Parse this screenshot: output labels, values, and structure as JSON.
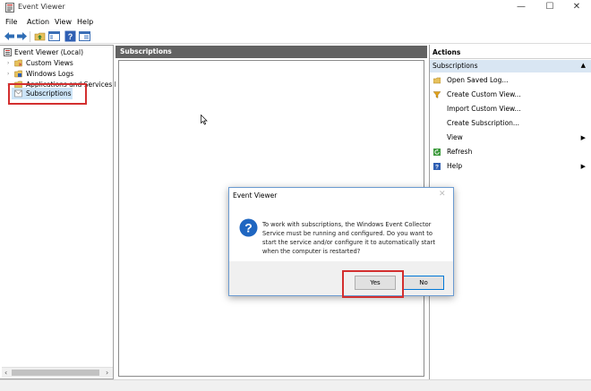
{
  "window": {
    "title": "Event Viewer",
    "minimize_glyph": "—",
    "maximize_glyph": "☐",
    "close_glyph": "✕"
  },
  "menu": [
    "File",
    "Action",
    "View",
    "Help"
  ],
  "toolbar": {
    "icons": [
      "back-arrow-icon",
      "forward-arrow-icon",
      "folder-up-icon",
      "show-hide-pane-icon",
      "help-icon",
      "properties-icon"
    ]
  },
  "tree": {
    "root": "Event Viewer (Local)",
    "items": [
      {
        "label": "Custom Views"
      },
      {
        "label": "Windows Logs"
      },
      {
        "label": "Applications and Services Log"
      },
      {
        "label": "Subscriptions"
      }
    ]
  },
  "center": {
    "header": "Subscriptions"
  },
  "actions": {
    "header": "Actions",
    "section": "Subscriptions",
    "items": [
      {
        "label": "Open Saved Log...",
        "icon": "folder-open-icon",
        "submenu": false
      },
      {
        "label": "Create Custom View...",
        "icon": "filter-icon",
        "submenu": false
      },
      {
        "label": "Import Custom View...",
        "icon": "",
        "submenu": false
      },
      {
        "label": "Create Subscription...",
        "icon": "",
        "submenu": false
      },
      {
        "label": "View",
        "icon": "",
        "submenu": true
      },
      {
        "label": "Refresh",
        "icon": "refresh-icon",
        "submenu": false
      },
      {
        "label": "Help",
        "icon": "help-icon",
        "submenu": true
      }
    ]
  },
  "dialog": {
    "title": "Event Viewer",
    "close_glyph": "✕",
    "message": "To work with subscriptions, the Windows Event Collector Service must be running and configured.  Do you want to start the service and/or configure it to automatically start when the computer is restarted?",
    "yes_label": "Yes",
    "no_label": "No"
  },
  "colors": {
    "accent": "#0078d7",
    "highlight": "#d32f2f",
    "header_gray": "#626262",
    "selection_blue": "#d9e6f3"
  }
}
